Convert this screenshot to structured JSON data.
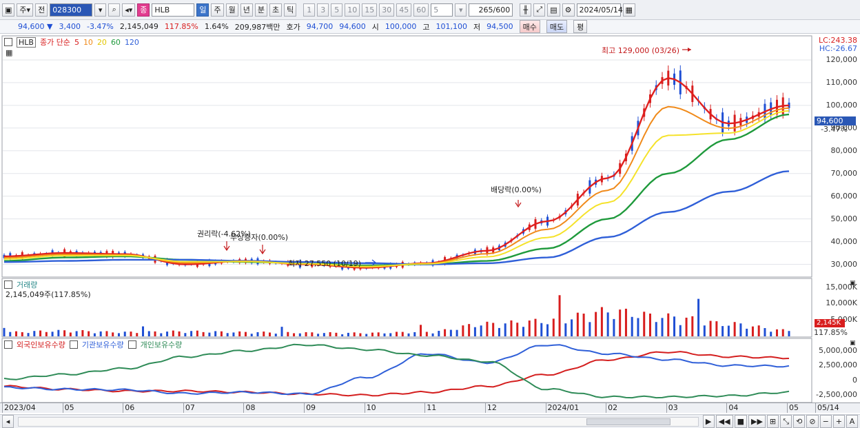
{
  "toolbar": {
    "market_label": "주",
    "prev_label": "전",
    "code": "028300",
    "name_badge": "종",
    "name": "HLB",
    "periods": [
      "일",
      "주",
      "월",
      "년",
      "분",
      "초",
      "틱"
    ],
    "intervals": [
      "1",
      "3",
      "5",
      "10",
      "15",
      "30",
      "45",
      "60"
    ],
    "interval_value": "5",
    "count": "265",
    "count_total": "/600",
    "date": "2024/05/14"
  },
  "quote": {
    "price": "94,600",
    "change": "3,400",
    "change_pct": "-3.47%",
    "volume": "2,145,049",
    "volume_ratio": "117.85%",
    "turnover": "1.64%",
    "amount": "209,987백만",
    "bid_label": "호가",
    "bid1": "94,700",
    "bid2": "94,600",
    "open_label": "시",
    "open": "100,000",
    "high_label": "고",
    "high": "101,100",
    "low_label": "저",
    "low": "94,500",
    "buy_label": "매수",
    "sell_label": "매도",
    "eval_label": "평"
  },
  "price_panel": {
    "name": "HLB",
    "ma_title": "종가 단순",
    "ma_periods": [
      "5",
      "10",
      "20",
      "60",
      "120"
    ],
    "lc": "LC:243.38",
    "hc": "HC:-26.67",
    "y_labels": [
      "120,000",
      "110,000",
      "100,000",
      "90,000",
      "80,000",
      "70,000",
      "60,000",
      "50,000",
      "40,000",
      "30,000"
    ],
    "current_price": "94,600",
    "current_pct": "-3.47%",
    "annotations": {
      "high": "최고 129,000 (03/26)",
      "dividend": "배당락(0.00%)",
      "rights": "권리락(-4.62%)",
      "bonus": "무상증자(0.00%)",
      "low": "최저 27,550 (10/19)"
    }
  },
  "volume_panel": {
    "title": "거래량",
    "value": "2,145,049주(117.85%)",
    "y_labels": [
      "15,000K",
      "10,000K",
      "5,000K"
    ],
    "current": "2,145K",
    "current_pct": "117.85%"
  },
  "holdings_panel": {
    "series_names": [
      "외국인보유수량",
      "기관보유수량",
      "개인보유수량"
    ],
    "y_labels": [
      "5,000,000",
      "2,500,000",
      "0",
      "-2,500,000"
    ]
  },
  "x_axis": {
    "labels": [
      "2023/04",
      "05",
      "06",
      "07",
      "08",
      "09",
      "10",
      "11",
      "12",
      "2024/01",
      "02",
      "03",
      "04",
      "05",
      "05/14"
    ]
  },
  "colors": {
    "ma5": "#e0201e",
    "ma10": "#f08a1a",
    "ma20": "#f5e22a",
    "ma60": "#1f9a3c",
    "ma120": "#2f5fd8",
    "foreign": "#d41e1e",
    "institution": "#2f5fd8",
    "individual": "#2e8b57"
  },
  "chart_data": [
    {
      "type": "line",
      "title": "HLB",
      "x": [
        "2023/04",
        "05",
        "06",
        "07",
        "08",
        "09",
        "10",
        "11",
        "12",
        "2024/01",
        "02",
        "03",
        "04",
        "05"
      ],
      "series": [
        {
          "name": "5",
          "values": [
            33500,
            35000,
            34500,
            30000,
            31500,
            30000,
            28500,
            30500,
            36000,
            49000,
            68000,
            112000,
            92000,
            100000
          ]
        },
        {
          "name": "60",
          "values": [
            31500,
            33000,
            33500,
            32000,
            31000,
            30500,
            29500,
            30000,
            31500,
            37000,
            50000,
            70000,
            85000,
            96000
          ]
        },
        {
          "name": "120",
          "values": [
            31000,
            31500,
            32000,
            32000,
            31500,
            31000,
            30500,
            30000,
            30500,
            33000,
            42000,
            53000,
            62000,
            71000
          ]
        }
      ],
      "ylim": [
        25000,
        130000
      ]
    },
    {
      "type": "bar",
      "title": "거래량",
      "categories": [
        "2023/04",
        "05",
        "06",
        "07",
        "08",
        "09",
        "10",
        "11",
        "12",
        "2024/01",
        "02",
        "03",
        "04",
        "05"
      ],
      "values": [
        1500,
        2000,
        1500,
        1800,
        1500,
        1300,
        1200,
        1600,
        4500,
        5500,
        9000,
        7000,
        4500,
        2145
      ],
      "ylabel": "K"
    },
    {
      "type": "line",
      "series": [
        {
          "name": "외국인보유수량",
          "values": [
            -1000000,
            -1500000,
            -1800000,
            -1800000,
            -2000000,
            -2300000,
            -2500000,
            -2000000,
            -1000000,
            1000000,
            3500000,
            4800000,
            4000000,
            3800000
          ]
        },
        {
          "name": "기관보유수량",
          "values": [
            -1200000,
            -1500000,
            -1600000,
            -2200000,
            -2000000,
            -2300000,
            500000,
            4500000,
            3000000,
            6000000,
            4500000,
            3500000,
            2500000,
            2400000
          ]
        },
        {
          "name": "개인보유수량",
          "values": [
            200000,
            1000000,
            2000000,
            4000000,
            5000000,
            6000000,
            5200000,
            4200000,
            3200000,
            -1500000,
            -2800000,
            -2800000,
            -2600000,
            -2000000
          ]
        }
      ]
    }
  ]
}
